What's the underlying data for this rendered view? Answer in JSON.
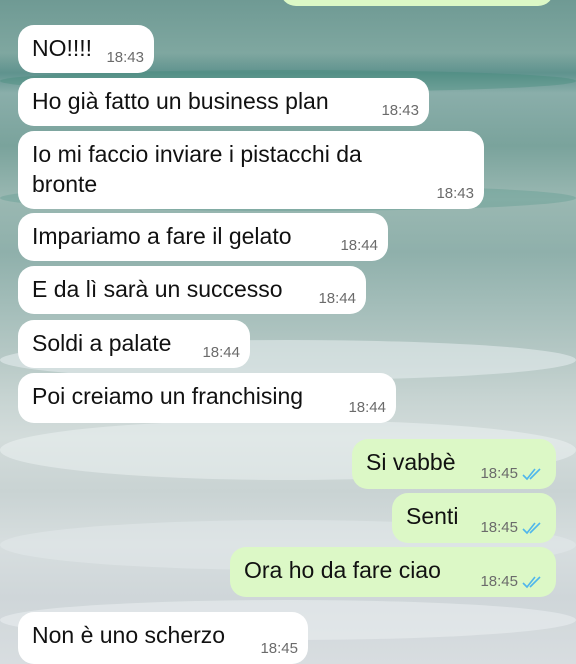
{
  "messages": [
    {
      "text": "NO!!!!",
      "time": "18:43",
      "dir": "in"
    },
    {
      "text": "Ho già fatto un business plan",
      "time": "18:43",
      "dir": "in"
    },
    {
      "text": "Io mi faccio inviare i pistacchi da bronte",
      "time": "18:43",
      "dir": "in"
    },
    {
      "text": "Impariamo a fare il gelato",
      "time": "18:44",
      "dir": "in"
    },
    {
      "text": "E da lì sarà un successo",
      "time": "18:44",
      "dir": "in"
    },
    {
      "text": "Soldi a palate",
      "time": "18:44",
      "dir": "in"
    },
    {
      "text": "Poi creiamo un franchising",
      "time": "18:44",
      "dir": "in"
    },
    {
      "text": "Si vabbè",
      "time": "18:45",
      "dir": "out",
      "status": "read"
    },
    {
      "text": "Senti",
      "time": "18:45",
      "dir": "out",
      "status": "read"
    },
    {
      "text": "Ora ho da fare ciao",
      "time": "18:45",
      "dir": "out",
      "status": "read"
    },
    {
      "text": "Non è uno scherzo",
      "time": "18:45",
      "dir": "in"
    }
  ],
  "colors": {
    "incoming": "#ffffff",
    "outgoing": "#dcf8c6",
    "read_ticks": "#4fb6ec"
  }
}
